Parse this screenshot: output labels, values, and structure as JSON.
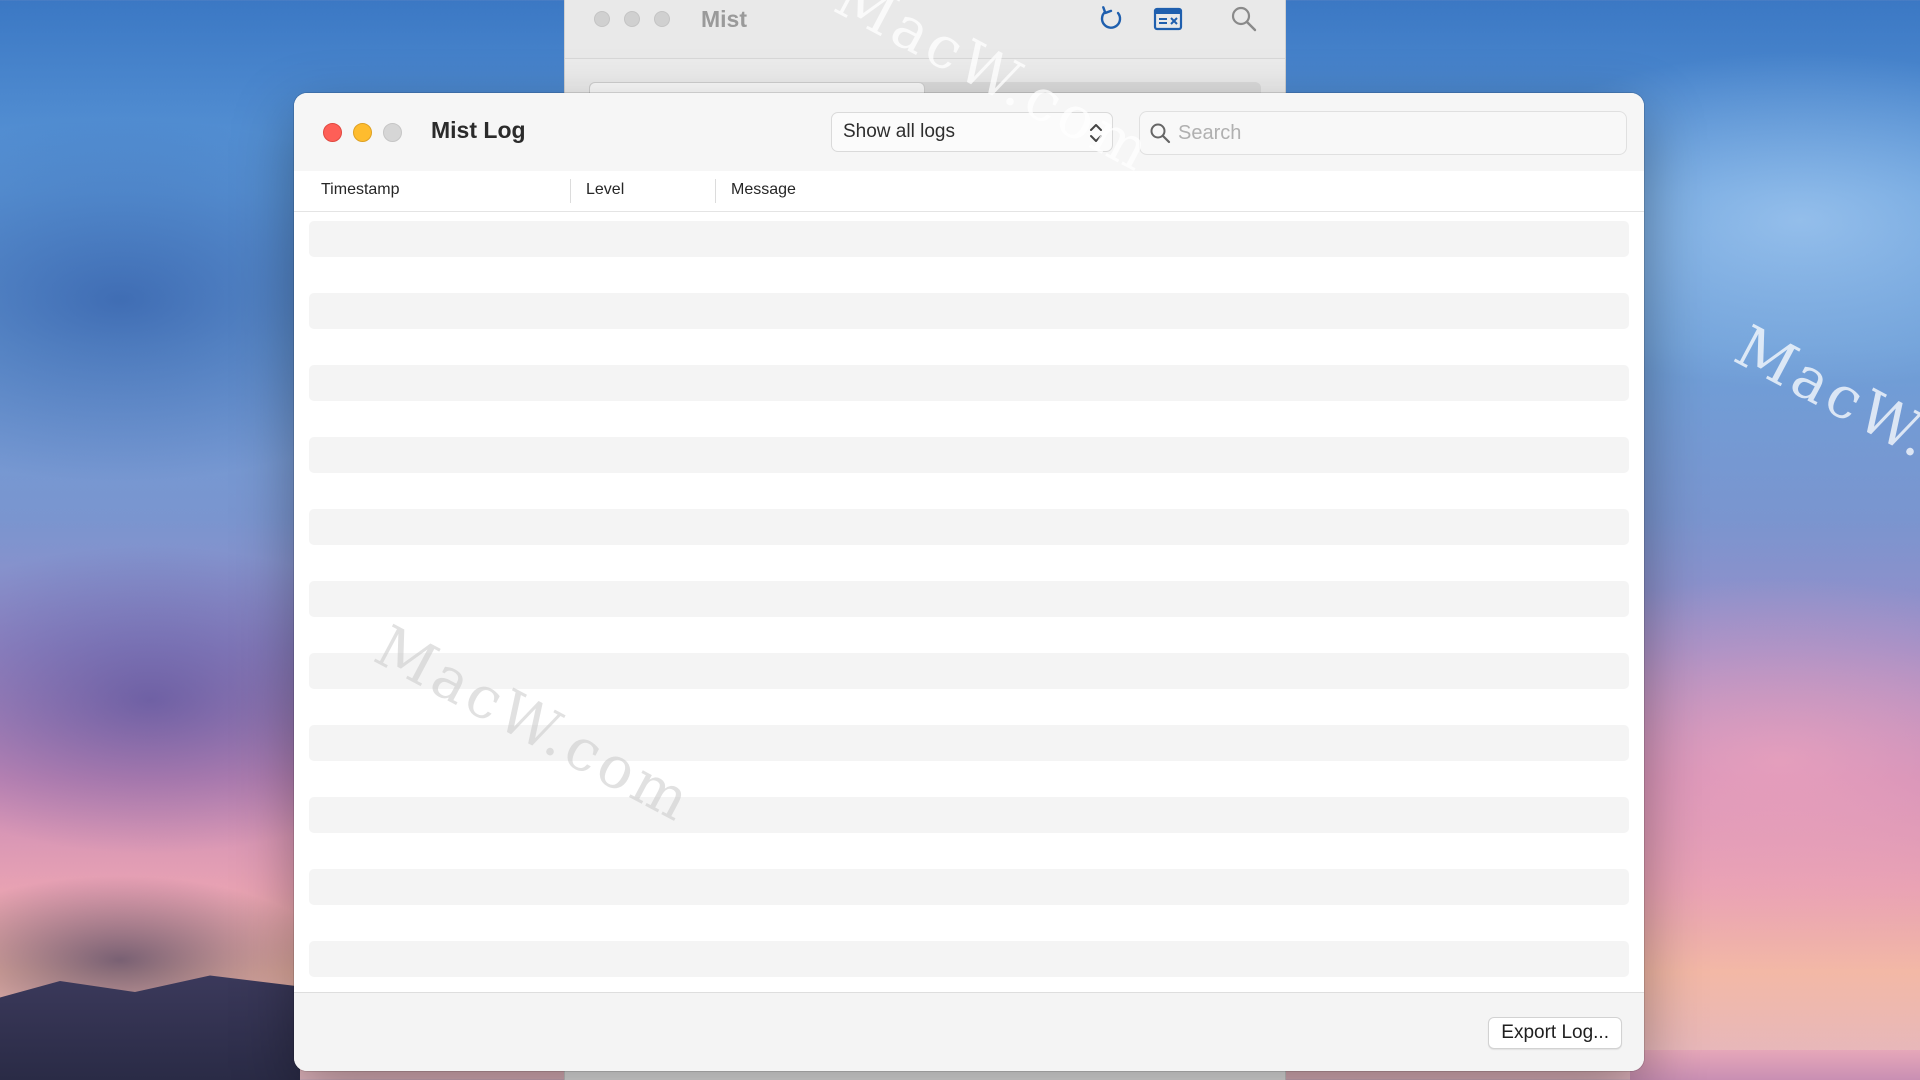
{
  "background_window": {
    "title": "Mist"
  },
  "log_window": {
    "title": "Mist Log",
    "filter": {
      "selected": "Show all logs"
    },
    "search": {
      "placeholder": "Search",
      "value": ""
    },
    "columns": [
      {
        "label": "Timestamp"
      },
      {
        "label": "Level"
      },
      {
        "label": "Message"
      }
    ],
    "rows": [],
    "footer": {
      "export_label": "Export Log..."
    }
  },
  "watermark": {
    "text": "MacW.com"
  },
  "colors": {
    "close": "#fe5f57",
    "minimize": "#febc2e",
    "zoom_disabled": "#d6d6d6",
    "accent_icon": "#1f5fae"
  }
}
